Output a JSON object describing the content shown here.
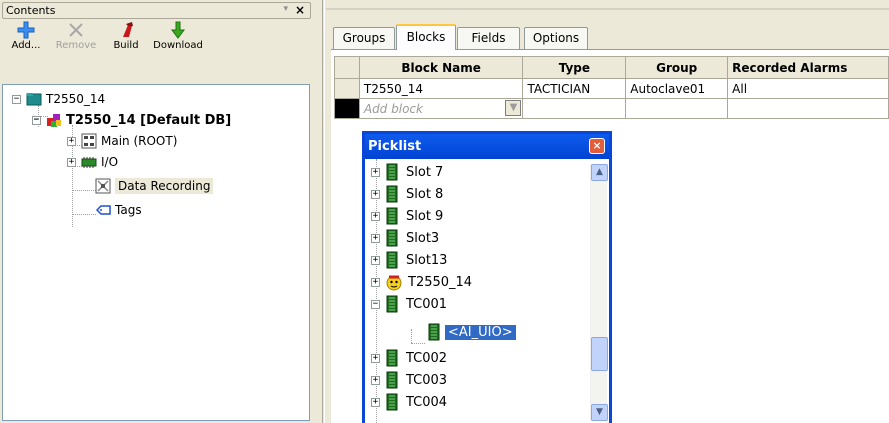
{
  "left_panel": {
    "title": "Contents",
    "dropdown_glyph": "▾",
    "close_glyph": "×",
    "toolbar": {
      "add": "Add...",
      "remove": "Remove",
      "build": "Build",
      "download": "Download"
    },
    "tree": {
      "root": "T2550_14",
      "db": "T2550_14 [Default DB]",
      "main": "Main (ROOT)",
      "io": "I/O",
      "data_recording": "Data Recording",
      "tags": "Tags"
    }
  },
  "tabs": [
    "Groups",
    "Blocks",
    "Fields",
    "Options"
  ],
  "active_tab": "Blocks",
  "grid": {
    "headers": [
      "Block Name",
      "Type",
      "Group",
      "Recorded Alarms"
    ],
    "rows": [
      [
        "T2550_14",
        "TACTICIAN",
        "Autoclave01",
        "All"
      ]
    ],
    "new_row_placeholder": "Add block",
    "dropdown_glyph": "▼"
  },
  "picklist": {
    "title": "Picklist",
    "close_glyph": "×",
    "items": [
      "Slot 7",
      "Slot 8",
      "Slot 9",
      "Slot3",
      "Slot13",
      "T2550_14",
      "TC001",
      "<AI_UIO>",
      "TC002",
      "TC003",
      "TC004"
    ],
    "selected": "<AI_UIO>"
  },
  "colors": {
    "accent_blue": "#0a46d8",
    "selection": "#316ac5",
    "tab_highlight": "#ffc83c",
    "panel_bg": "#ece9d8"
  }
}
